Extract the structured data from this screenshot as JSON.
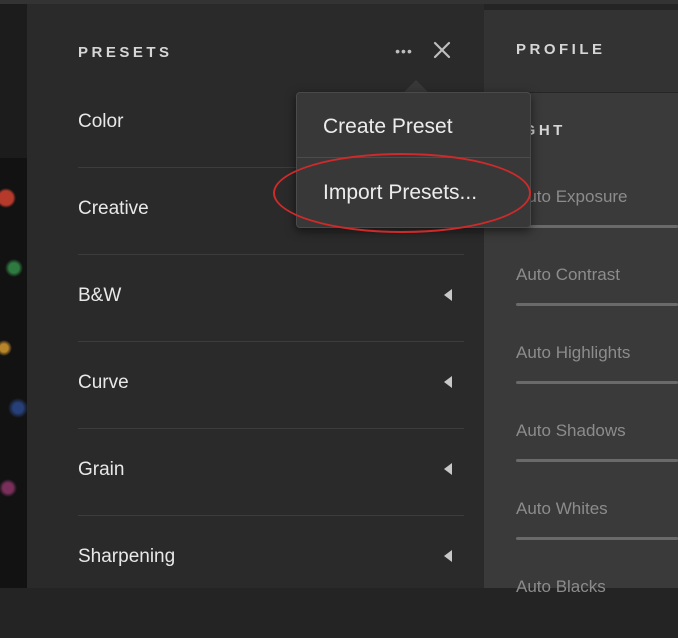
{
  "presets_panel": {
    "title": "PRESETS",
    "more_icon": "•••",
    "items": [
      {
        "label": "Color",
        "has_caret": false
      },
      {
        "label": "Creative",
        "has_caret": false
      },
      {
        "label": "B&W",
        "has_caret": true
      },
      {
        "label": "Curve",
        "has_caret": true
      },
      {
        "label": "Grain",
        "has_caret": true
      },
      {
        "label": "Sharpening",
        "has_caret": true
      }
    ]
  },
  "dropdown_menu": {
    "items": [
      {
        "label": "Create Preset"
      },
      {
        "label": "Import Presets..."
      }
    ],
    "highlighted_item": "Import Presets...",
    "highlight_color": "#cf2a2a"
  },
  "edit_panel": {
    "profile_label": "PROFILE",
    "section_label": "IGHT",
    "auto_buttons": [
      {
        "label": "Auto Exposure"
      },
      {
        "label": "Auto Contrast"
      },
      {
        "label": "Auto Highlights"
      },
      {
        "label": "Auto Shadows"
      },
      {
        "label": "Auto Whites"
      },
      {
        "label": "Auto Blacks"
      }
    ]
  },
  "colors": {
    "background": "#242424",
    "panel": "#2a2a2a",
    "menu": "#383838",
    "text": "#e8e8e8",
    "muted_text": "#8c8c8c"
  }
}
